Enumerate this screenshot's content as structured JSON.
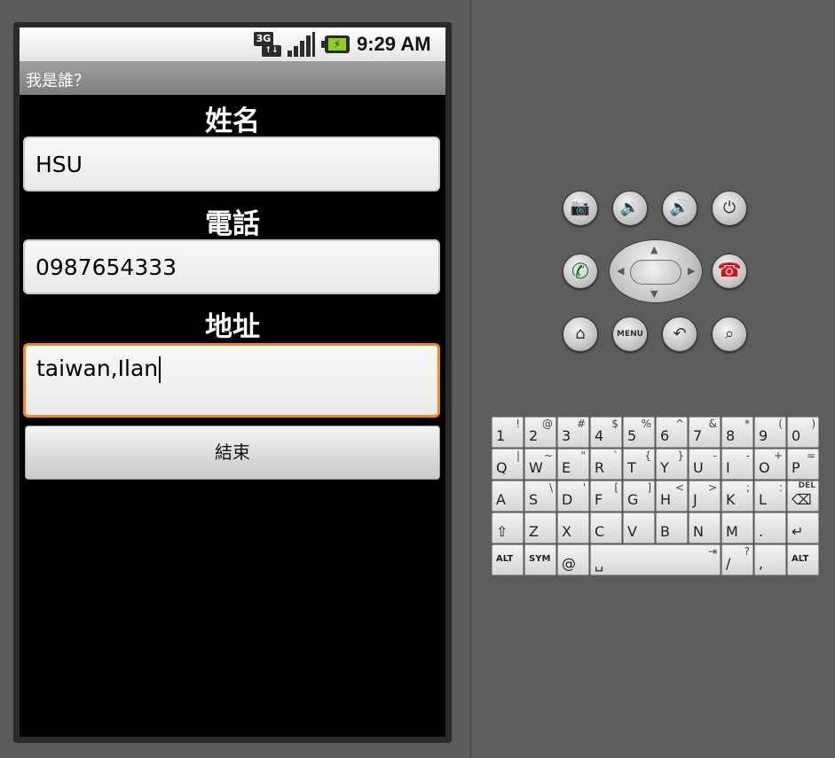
{
  "status_bar": {
    "network_label": "3G",
    "network_arrows": "↑↓",
    "time": "9:29 AM",
    "battery_charge_glyph": "⚡"
  },
  "title": "我是誰？",
  "form": {
    "name_label": "姓名",
    "name_value": "HSU",
    "phone_label": "電話",
    "phone_value": "0987654333",
    "address_label": "地址",
    "address_value": "taiwan,Ilan",
    "finish_label": "結束"
  },
  "controls": {
    "camera_icon": "📷",
    "volume_down_icon": "🔉",
    "volume_up_icon": "🔊",
    "power_icon": "⏻",
    "call_icon": "✆",
    "end_call_icon": "☎",
    "home_icon": "⌂",
    "menu_label": "MENU",
    "back_icon": "↶",
    "search_icon": "⌕",
    "dpad_up": "▲",
    "dpad_down": "▼",
    "dpad_left": "◀",
    "dpad_right": "▶"
  },
  "keyboard": {
    "rows": [
      [
        {
          "k": "1",
          "a": "!"
        },
        {
          "k": "2",
          "a": "@"
        },
        {
          "k": "3",
          "a": "#"
        },
        {
          "k": "4",
          "a": "$"
        },
        {
          "k": "5",
          "a": "%"
        },
        {
          "k": "6",
          "a": "^"
        },
        {
          "k": "7",
          "a": "&"
        },
        {
          "k": "8",
          "a": "*"
        },
        {
          "k": "9",
          "a": "("
        },
        {
          "k": "0",
          "a": ")"
        }
      ],
      [
        {
          "k": "Q",
          "a": "|"
        },
        {
          "k": "W",
          "a": "~"
        },
        {
          "k": "E",
          "a": "\""
        },
        {
          "k": "R",
          "a": "`"
        },
        {
          "k": "T",
          "a": "{"
        },
        {
          "k": "Y",
          "a": "}"
        },
        {
          "k": "U",
          "a": "-"
        },
        {
          "k": "I",
          "a": "-"
        },
        {
          "k": "O",
          "a": "+"
        },
        {
          "k": "P",
          "a": "="
        }
      ],
      [
        {
          "k": "A",
          "a": ""
        },
        {
          "k": "S",
          "a": "\\"
        },
        {
          "k": "D",
          "a": "'"
        },
        {
          "k": "F",
          "a": "["
        },
        {
          "k": "G",
          "a": "]"
        },
        {
          "k": "H",
          "a": "<"
        },
        {
          "k": "J",
          "a": ">"
        },
        {
          "k": "K",
          "a": ";"
        },
        {
          "k": "L",
          "a": ":"
        },
        {
          "k": "⌫",
          "a": "DEL"
        }
      ],
      [
        {
          "k": "⇧",
          "a": ""
        },
        {
          "k": "Z",
          "a": ""
        },
        {
          "k": "X",
          "a": ""
        },
        {
          "k": "C",
          "a": ""
        },
        {
          "k": "V",
          "a": ""
        },
        {
          "k": "B",
          "a": ""
        },
        {
          "k": "N",
          "a": ""
        },
        {
          "k": "M",
          "a": ""
        },
        {
          "k": ".",
          "a": ""
        },
        {
          "k": "↵",
          "a": ""
        }
      ],
      [
        {
          "k": "ALT",
          "a": ""
        },
        {
          "k": "SYM",
          "a": ""
        },
        {
          "k": "@",
          "a": ""
        },
        {
          "k": "␣",
          "a": "⇥"
        },
        {
          "k": "/",
          "a": "?"
        },
        {
          "k": ",",
          "a": ""
        },
        {
          "k": "ALT",
          "a": ""
        }
      ]
    ]
  }
}
